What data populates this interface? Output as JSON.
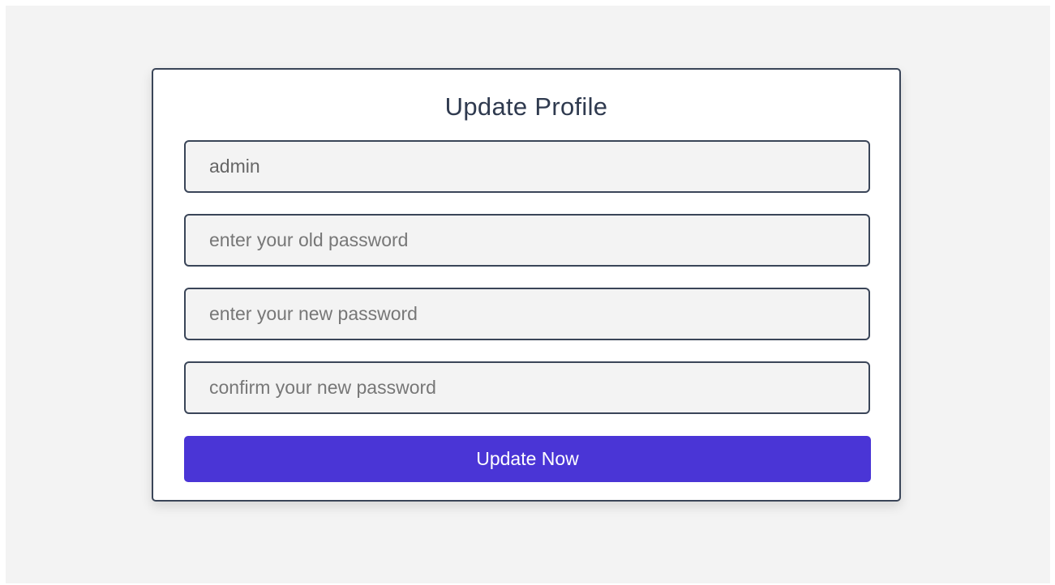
{
  "form": {
    "title": "Update Profile",
    "username_value": "admin",
    "old_password_placeholder": "enter your old password",
    "new_password_placeholder": "enter your new password",
    "confirm_password_placeholder": "confirm your new password",
    "submit_label": "Update Now"
  },
  "colors": {
    "page_background": "#f3f3f3",
    "card_border": "#3a4558",
    "button_background": "#4a35d6",
    "button_text": "#ffffff"
  }
}
